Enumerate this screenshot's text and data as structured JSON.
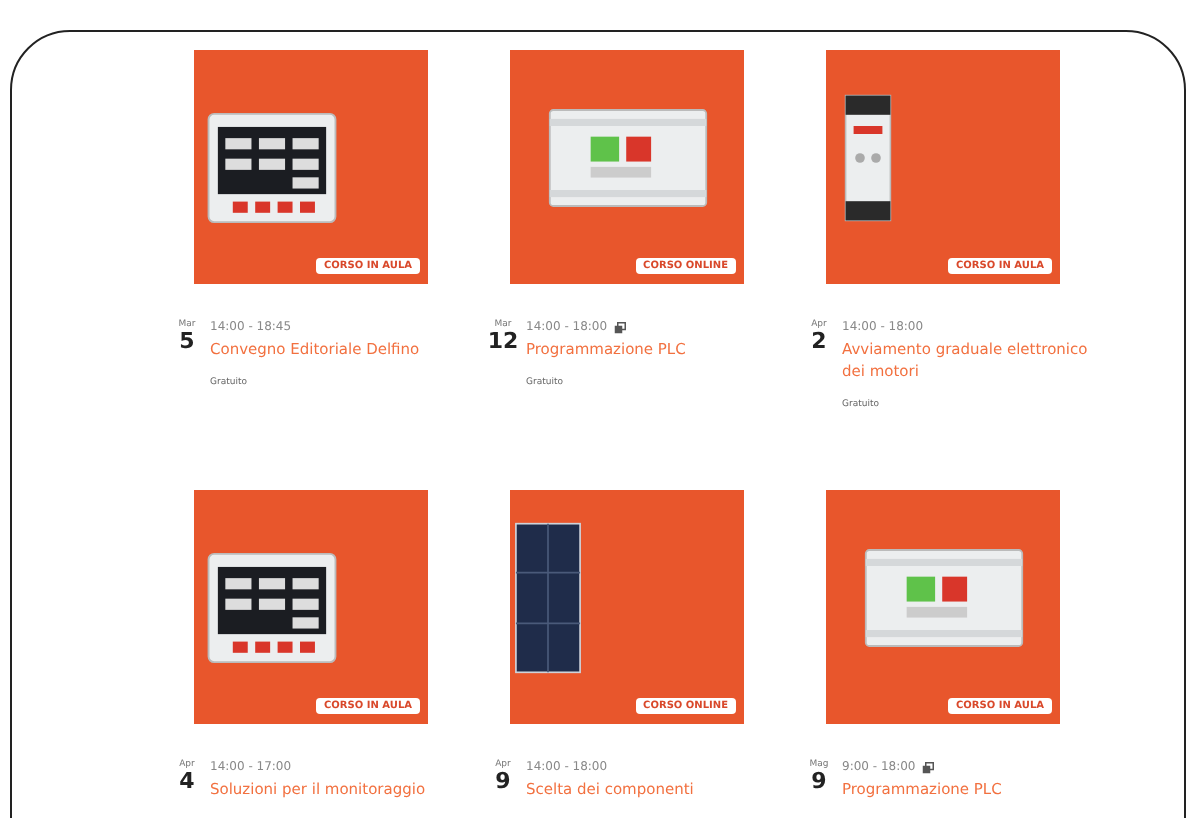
{
  "events": [
    {
      "kind": "meter",
      "badge": "CORSO IN AULA",
      "month": "Mar",
      "day": "5",
      "time": "14:00 - 18:45",
      "extra_icon": false,
      "title": "Convegno Editoriale Delfino",
      "price": "Gratuito"
    },
    {
      "kind": "plc",
      "badge": "CORSO ONLINE",
      "month": "Mar",
      "day": "12",
      "time": "14:00 - 18:00",
      "extra_icon": true,
      "title": "Programmazione PLC",
      "price": "Gratuito"
    },
    {
      "kind": "starter",
      "badge": "CORSO IN AULA",
      "month": "Apr",
      "day": "2",
      "time": "14:00 - 18:00",
      "extra_icon": false,
      "title": "Avviamento graduale elettronico dei motori",
      "price": "Gratuito"
    },
    {
      "kind": "meter",
      "badge": "CORSO IN AULA",
      "month": "Apr",
      "day": "4",
      "time": "14:00 - 17:00",
      "extra_icon": false,
      "title": "Soluzioni per il monitoraggio"
    },
    {
      "kind": "panel",
      "badge": "CORSO ONLINE",
      "month": "Apr",
      "day": "9",
      "time": "14:00 - 18:00",
      "extra_icon": false,
      "title": "Scelta dei componenti"
    },
    {
      "kind": "plc",
      "badge": "CORSO IN AULA",
      "month": "Mag",
      "day": "9",
      "time": "9:00 - 18:00",
      "extra_icon": true,
      "title": "Programmazione PLC"
    }
  ]
}
